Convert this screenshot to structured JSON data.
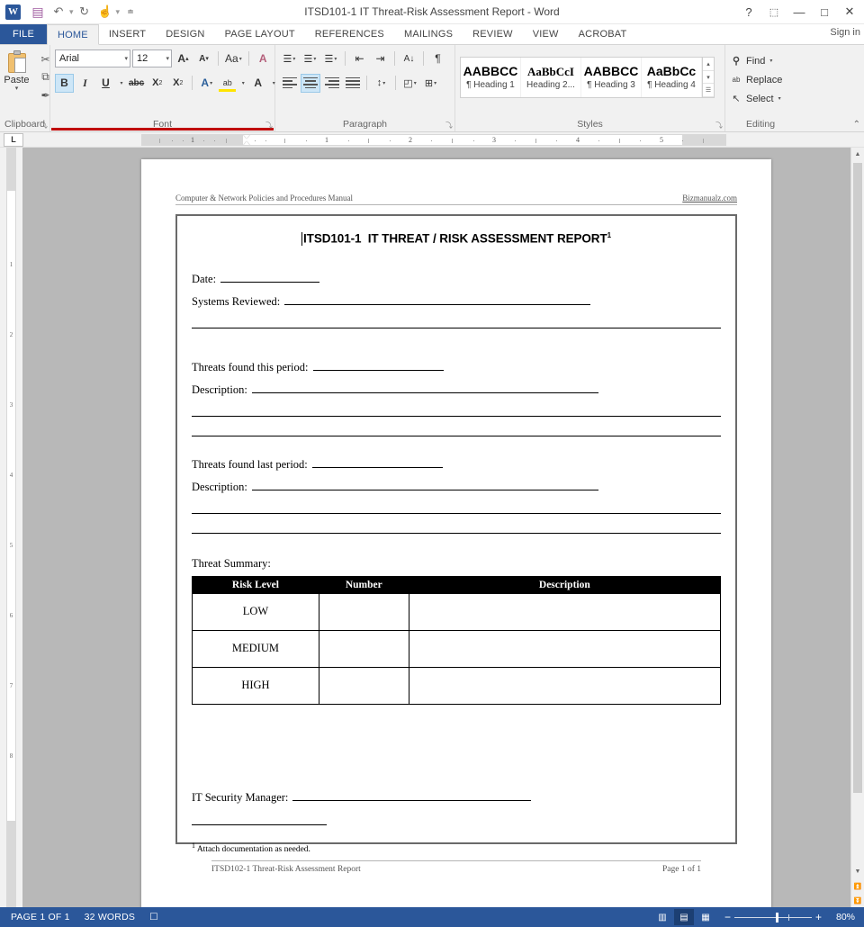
{
  "titlebar": {
    "app_icon": "word-logo",
    "document_title": "ITSD101-1 IT Threat-Risk Assessment Report - Word",
    "qat": [
      {
        "name": "save-icon",
        "glyph": "▤"
      },
      {
        "name": "undo-icon",
        "glyph": "↶"
      },
      {
        "name": "redo-icon",
        "glyph": "↻"
      },
      {
        "name": "touch-mode-icon",
        "glyph": "☝"
      },
      {
        "name": "customize-qat-icon",
        "glyph": "☰"
      }
    ],
    "help_glyph": "?",
    "ribbon_display_glyph": "⬚",
    "minimize_glyph": "—",
    "maximize_glyph": "□",
    "close_glyph": "✕",
    "signin_label": "Sign in"
  },
  "tabs": [
    {
      "label": "FILE",
      "active": false
    },
    {
      "label": "HOME",
      "active": true
    },
    {
      "label": "INSERT",
      "active": false
    },
    {
      "label": "DESIGN",
      "active": false
    },
    {
      "label": "PAGE LAYOUT",
      "active": false
    },
    {
      "label": "REFERENCES",
      "active": false
    },
    {
      "label": "MAILINGS",
      "active": false
    },
    {
      "label": "REVIEW",
      "active": false
    },
    {
      "label": "VIEW",
      "active": false
    },
    {
      "label": "ACROBAT",
      "active": false
    }
  ],
  "ribbon": {
    "clipboard": {
      "title": "Clipboard",
      "paste_label": "Paste",
      "paste_caret": "▾",
      "cut_glyph": "✂",
      "copy_glyph": "⧉",
      "format_painter_glyph": "✒",
      "launcher_glyph": "⤵"
    },
    "font": {
      "title": "Font",
      "font_name": "Arial",
      "font_size": "12",
      "grow_font": "A",
      "shrink_font": "A",
      "change_case": "Aa",
      "clear_formatting": "A",
      "bold": "B",
      "italic": "I",
      "underline": "U",
      "strikethrough": "abc",
      "subscript": "X",
      "superscript": "X",
      "text_effects": "A",
      "highlight": "ab",
      "font_color": "A",
      "launcher_glyph": "⤵"
    },
    "paragraph": {
      "title": "Paragraph",
      "bullets_glyph": "☰",
      "numbering_glyph": "☰",
      "multilevel_glyph": "☰",
      "decrease_indent_glyph": "⇤",
      "increase_indent_glyph": "⇥",
      "sort_glyph": "A↓",
      "show_marks_glyph": "¶",
      "align_left_glyph": "≡",
      "align_center_glyph": "≡",
      "align_right_glyph": "≡",
      "justify_glyph": "≡",
      "line_spacing_glyph": "↕",
      "shading_glyph": "◰",
      "borders_glyph": "⊞",
      "active_alignment": "center",
      "launcher_glyph": "⤵"
    },
    "styles": {
      "title": "Styles",
      "items": [
        {
          "preview": "AABBCC",
          "name": "¶ Heading 1",
          "serif": false
        },
        {
          "preview": "AaBbCcI",
          "name": "Heading 2...",
          "serif": true
        },
        {
          "preview": "AABBCC",
          "name": "¶ Heading 3",
          "serif": false
        },
        {
          "preview": "AaBbCc",
          "name": "¶ Heading 4",
          "serif": false
        }
      ],
      "scroll_up": "▴",
      "scroll_down": "▾",
      "scroll_more": "☰",
      "launcher_glyph": "⤵"
    },
    "editing": {
      "title": "Editing",
      "find_label": "Find",
      "find_caret": "▾",
      "find_icon_glyph": "🔍",
      "replace_label": "Replace",
      "replace_icon_glyph": "ab",
      "select_label": "Select",
      "select_caret": "▾",
      "select_icon_glyph": "↖"
    },
    "collapse_glyph": "⌃"
  },
  "rulers": {
    "corner_tab_label": "L",
    "horizontal_numbers": [
      "1",
      "1",
      "2",
      "3",
      "4",
      "5"
    ],
    "vertical_numbers": [
      "1",
      "2",
      "3",
      "4",
      "5",
      "6",
      "7",
      "8"
    ]
  },
  "document": {
    "header_left": "Computer & Network Policies and Procedures Manual",
    "header_right": "Bizmanualz.com",
    "title_prefix": "ITSD101-1",
    "title_main": "IT THREAT / RISK ASSESSMENT REPORT",
    "title_footnote_mark": "1",
    "fields": [
      {
        "label": "Date:",
        "fill_width": 110
      },
      {
        "label": "Systems Reviewed:",
        "fill_width": 380
      },
      {
        "label": "Threats found this period:",
        "fill_width": 145
      },
      {
        "label": "Description:",
        "fill_width": 380
      },
      {
        "label": "Threats found last period:",
        "fill_width": 145
      },
      {
        "label": "Description:",
        "fill_width": 380
      }
    ],
    "table_caption": "Threat Summary:",
    "table": {
      "headers": [
        "Risk Level",
        "Number",
        "Description"
      ],
      "rows": [
        {
          "risk_level": "LOW",
          "number": "",
          "description": ""
        },
        {
          "risk_level": "MEDIUM",
          "number": "",
          "description": ""
        },
        {
          "risk_level": "HIGH",
          "number": "",
          "description": ""
        }
      ]
    },
    "signature_label": "IT Security Manager:",
    "footnote_mark": "1",
    "footnote_text": "Attach documentation as needed.",
    "footer_left": "ITSD102-1 Threat-Risk Assessment Report",
    "footer_right": "Page 1 of 1"
  },
  "statusbar": {
    "page_indicator": "PAGE 1 OF 1",
    "word_count": "32 WORDS",
    "proofing_glyph": "☐",
    "read_mode_glyph": "📖",
    "print_layout_glyph": "☰",
    "web_layout_glyph": "⧉",
    "zoom_out_glyph": "−",
    "zoom_in_glyph": "+",
    "zoom_level": "80%"
  },
  "colors": {
    "word_blue": "#2b579a",
    "ribbon_bg": "#f1f1f1",
    "doc_bg": "#b8b8b8",
    "table_header_bg": "#000000"
  }
}
